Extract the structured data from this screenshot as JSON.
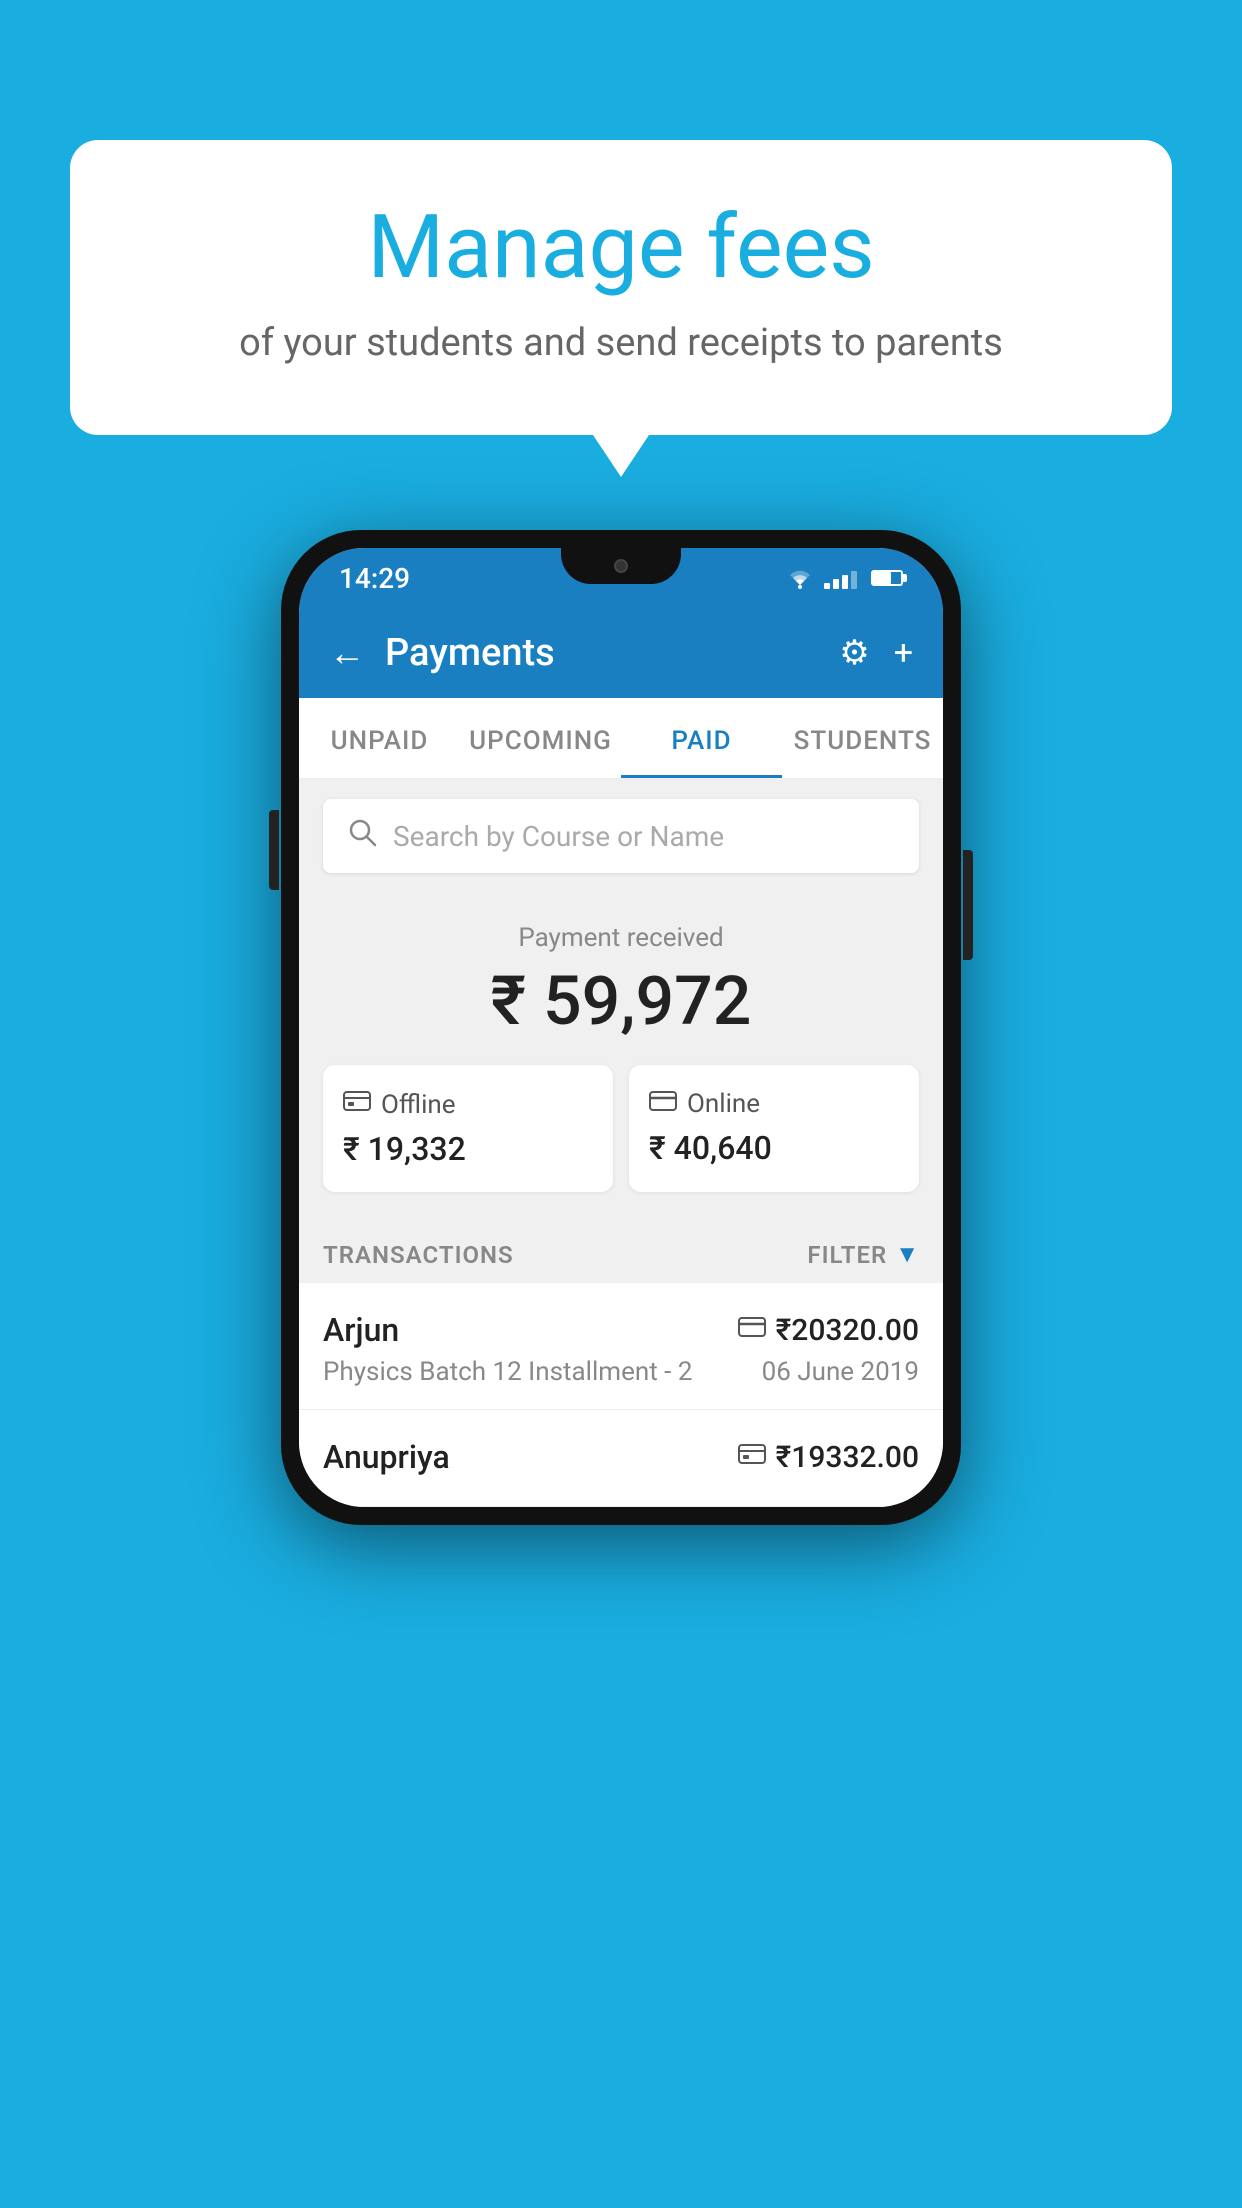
{
  "background_color": "#1AADE0",
  "speech_bubble": {
    "title": "Manage fees",
    "subtitle": "of your students and send receipts to parents"
  },
  "status_bar": {
    "time": "14:29"
  },
  "header": {
    "title": "Payments",
    "back_label": "←",
    "settings_label": "⚙",
    "add_label": "+"
  },
  "tabs": [
    {
      "label": "UNPAID",
      "active": false
    },
    {
      "label": "UPCOMING",
      "active": false
    },
    {
      "label": "PAID",
      "active": true
    },
    {
      "label": "STUDENTS",
      "active": false
    }
  ],
  "search": {
    "placeholder": "Search by Course or Name"
  },
  "payment_summary": {
    "label": "Payment received",
    "total": "₹ 59,972",
    "offline_label": "Offline",
    "offline_amount": "₹ 19,332",
    "online_label": "Online",
    "online_amount": "₹ 40,640"
  },
  "transactions_header": {
    "label": "TRANSACTIONS",
    "filter_label": "FILTER"
  },
  "transactions": [
    {
      "name": "Arjun",
      "course": "Physics Batch 12 Installment - 2",
      "amount": "₹20320.00",
      "date": "06 June 2019",
      "payment_type": "online"
    },
    {
      "name": "Anupriya",
      "course": "",
      "amount": "₹19332.00",
      "date": "",
      "payment_type": "offline"
    }
  ]
}
